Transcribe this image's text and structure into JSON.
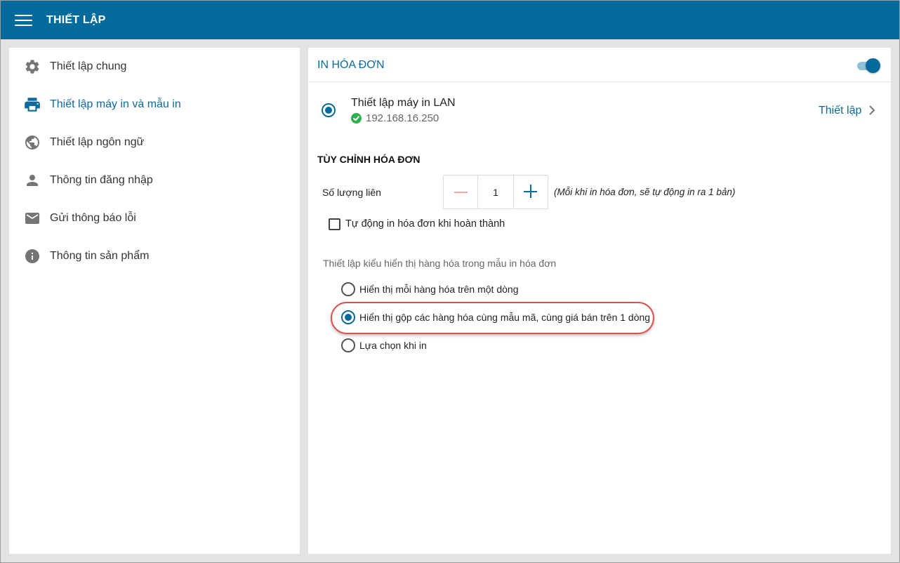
{
  "topbar": {
    "title": "THIẾT LẬP",
    "menu_icon": "hamburger-menu-icon"
  },
  "sidebar": {
    "items": [
      {
        "label": "Thiết lập chung",
        "icon": "gear-icon",
        "active": false
      },
      {
        "label": "Thiết lập máy in và mẫu in",
        "icon": "printer-icon",
        "active": true
      },
      {
        "label": "Thiết lập ngôn ngữ",
        "icon": "globe-icon",
        "active": false
      },
      {
        "label": "Thông tin đăng nhập",
        "icon": "person-icon",
        "active": false
      },
      {
        "label": "Gửi thông báo lỗi",
        "icon": "mail-icon",
        "active": false
      },
      {
        "label": "Thông tin sản phẩm",
        "icon": "info-icon",
        "active": false
      }
    ]
  },
  "main": {
    "title": "IN HÓA ĐƠN",
    "toggle_on": true,
    "printer": {
      "name": "Thiết lập máy in LAN",
      "ip": "192.168.16.250",
      "selected": true,
      "status_icon": "check-circle-icon",
      "setup_label": "Thiết lập"
    },
    "customize": {
      "title": "TÙY CHỈNH HÓA ĐƠN",
      "quantity_label": "Số lượng liên",
      "quantity_value": "1",
      "quantity_note": "(Mỗi khi in hóa đơn, sẽ tự động in ra 1 bản)",
      "auto_print_label": "Tự động in hóa đơn khi hoàn thành",
      "auto_print_checked": false
    },
    "display": {
      "title": "Thiết lập kiểu hiển thị hàng hóa trong mẫu in hóa đơn",
      "options": [
        {
          "label": "Hiển thị mỗi hàng hóa trên một dòng",
          "selected": false
        },
        {
          "label": "Hiển thị gộp các hàng hóa cùng mẫu mã, cùng giá bán trên 1 dòng",
          "selected": true
        },
        {
          "label": "Lựa chọn khi in",
          "selected": false
        }
      ]
    }
  },
  "colors": {
    "topbar": "#036b9b",
    "accent": "#0b6a9b",
    "highlight": "#d9534f",
    "success": "#2eb04f"
  }
}
